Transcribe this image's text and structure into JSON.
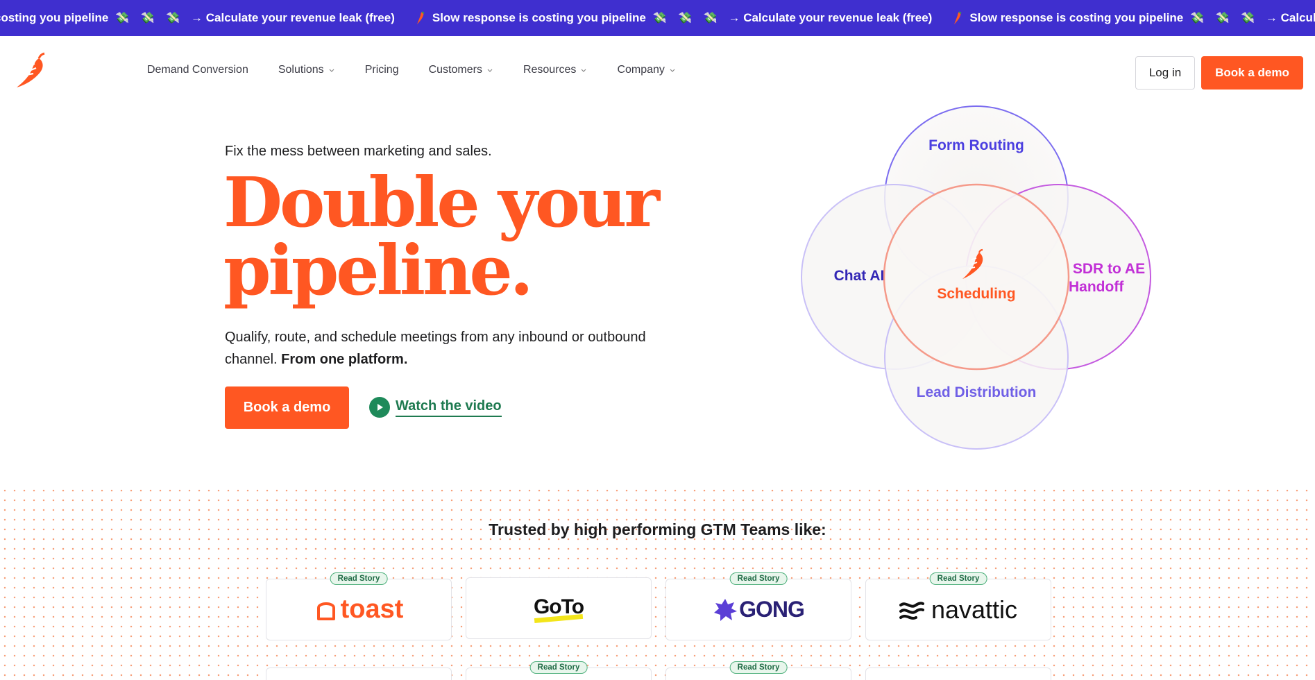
{
  "ticker": {
    "items": [
      {
        "text": "costing you pipeline",
        "cta": "→ Calculate your revenue leak (free)"
      },
      {
        "text": "Slow response is costing you pipeline",
        "cta": "→ Calculate your revenue leak (free)"
      },
      {
        "text": "Slow response is costing you pipeline",
        "cta": "→ Calculate your revenu"
      }
    ],
    "money_glyph": "💸 💸 💸",
    "bg_color": "#3f2fcf"
  },
  "nav": {
    "items": [
      {
        "label": "Demand Conversion",
        "has_dropdown": false
      },
      {
        "label": "Solutions",
        "has_dropdown": true
      },
      {
        "label": "Pricing",
        "has_dropdown": false
      },
      {
        "label": "Customers",
        "has_dropdown": true
      },
      {
        "label": "Resources",
        "has_dropdown": true
      },
      {
        "label": "Company",
        "has_dropdown": true
      }
    ],
    "login_label": "Log in",
    "demo_label": "Book a demo"
  },
  "hero": {
    "eyebrow": "Fix the mess between marketing and sales.",
    "headline_line1": "Double your",
    "headline_line2": "pipeline.",
    "sub_text": "Qualify, route, and schedule meetings from any inbound or outbound channel. ",
    "sub_bold": "From one platform.",
    "demo_label": "Book a demo",
    "watch_label": "Watch the video",
    "accent_color": "#ff5722"
  },
  "venn": {
    "top": "Form Routing",
    "left": "Chat AI",
    "center": "Scheduling",
    "right_line1": "SDR to AE",
    "right_line2": "Handoff",
    "bottom": "Lead Distribution"
  },
  "trusted": {
    "title": "Trusted by high performing GTM Teams like:",
    "read_story": "Read Story",
    "logos": [
      "toast",
      "GoTo",
      "GONG",
      "navattic"
    ]
  }
}
